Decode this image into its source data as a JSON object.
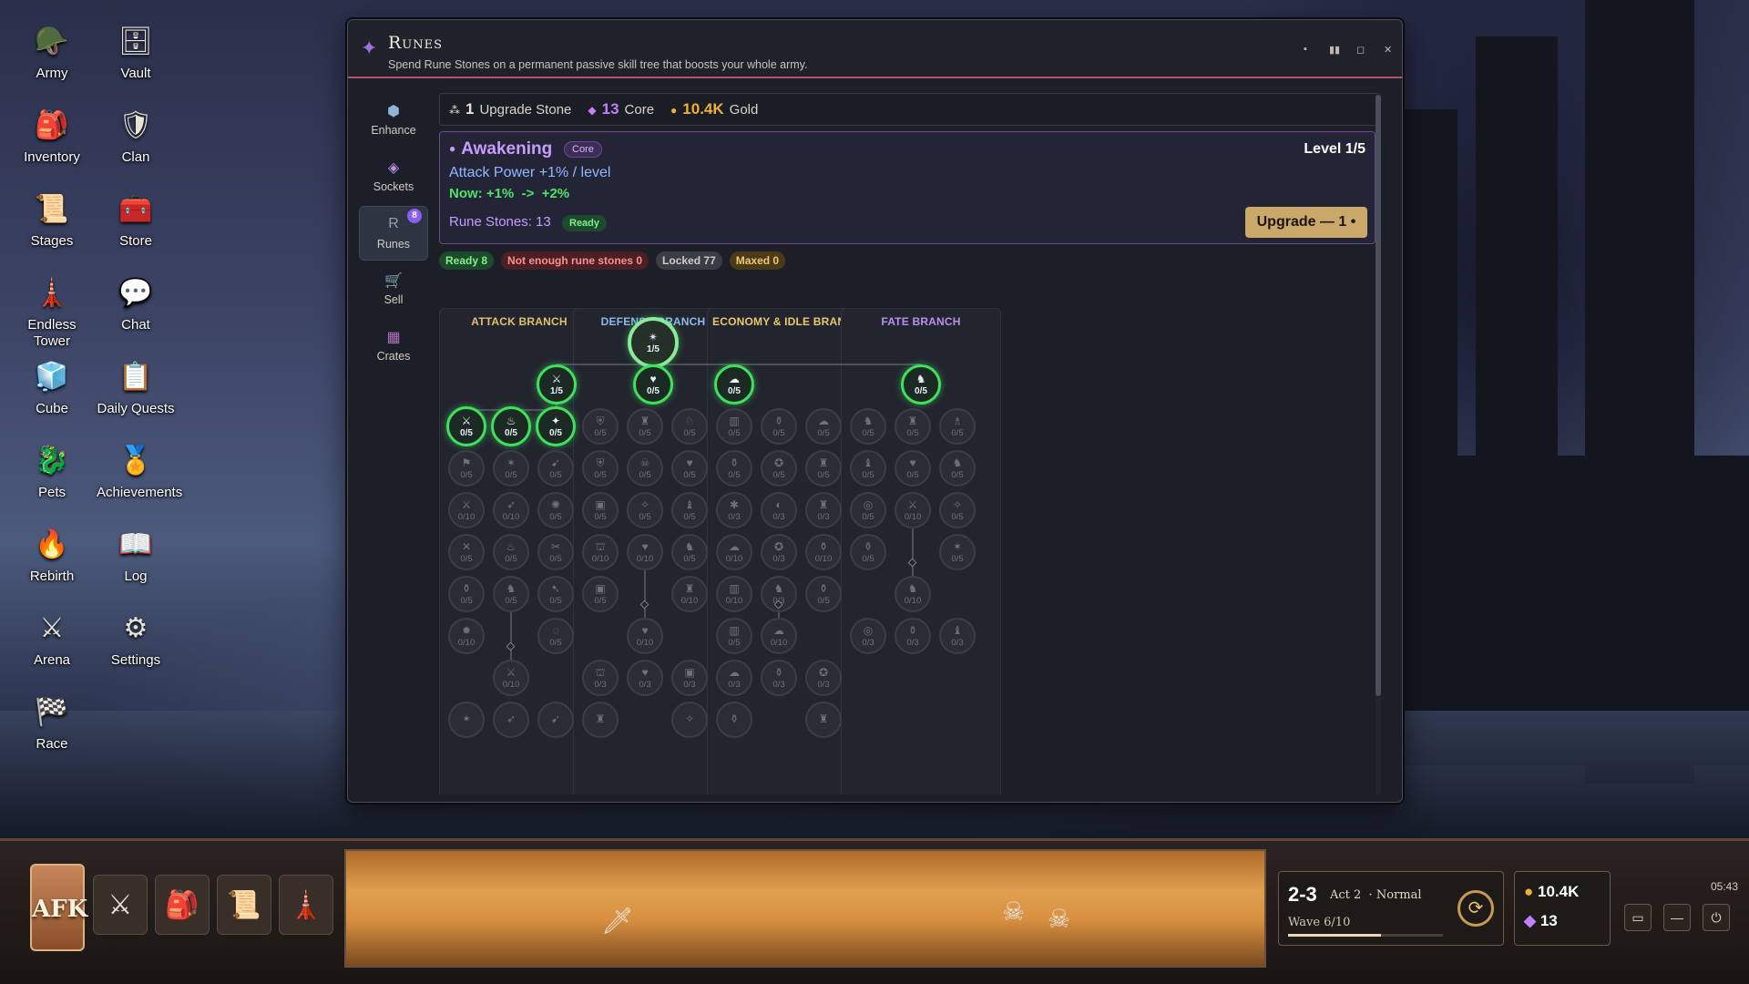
{
  "desktop": {
    "icons": [
      {
        "label": "Army",
        "glyph": "🪖",
        "icon": "army-icon"
      },
      {
        "label": "Vault",
        "glyph": "🗄",
        "icon": "vault-icon"
      },
      {
        "label": "Inventory",
        "glyph": "🎒",
        "icon": "inventory-icon"
      },
      {
        "label": "Clan",
        "glyph": "🛡",
        "icon": "clan-icon"
      },
      {
        "label": "Stages",
        "glyph": "📜",
        "icon": "stages-icon"
      },
      {
        "label": "Store",
        "glyph": "🧰",
        "icon": "store-icon"
      },
      {
        "label": "Endless Tower",
        "glyph": "🗼",
        "icon": "endless-tower-icon"
      },
      {
        "label": "Chat",
        "glyph": "💬",
        "icon": "chat-icon"
      },
      {
        "label": "Cube",
        "glyph": "🧊",
        "icon": "cube-icon"
      },
      {
        "label": "Daily Quests",
        "glyph": "📋",
        "icon": "daily-quests-icon"
      },
      {
        "label": "Pets",
        "glyph": "🐉",
        "icon": "pets-icon"
      },
      {
        "label": "Achievements",
        "glyph": "🏅",
        "icon": "achievements-icon"
      },
      {
        "label": "Rebirth",
        "glyph": "🔥",
        "icon": "rebirth-icon"
      },
      {
        "label": "Log",
        "glyph": "📖",
        "icon": "log-icon"
      },
      {
        "label": "Arena",
        "glyph": "⚔",
        "icon": "arena-icon"
      },
      {
        "label": "Settings",
        "glyph": "⚙",
        "icon": "settings-icon"
      },
      {
        "label": "Race",
        "glyph": "🏁",
        "icon": "race-icon"
      }
    ]
  },
  "window": {
    "title": "Runes",
    "subtitle": "Spend Rune Stones on a permanent passive skill tree that boosts your whole army.",
    "controls": [
      "▪",
      "▮▮",
      "◻",
      "✕"
    ]
  },
  "rail": [
    {
      "label": "Enhance",
      "glyph": "⬢",
      "icon": "enhance-icon",
      "color": "#8fb3d9",
      "active": false
    },
    {
      "label": "Sockets",
      "glyph": "◈",
      "icon": "sockets-icon",
      "color": "#b48ce0",
      "active": false
    },
    {
      "label": "Runes",
      "glyph": "R",
      "icon": "runes-icon",
      "color": "#9a9fb0",
      "active": true,
      "badge": "8"
    },
    {
      "label": "Sell",
      "glyph": "🛒",
      "icon": "sell-icon",
      "color": "#e0c060",
      "active": false
    },
    {
      "label": "Crates",
      "glyph": "▦",
      "icon": "crates-icon",
      "color": "#b070c0",
      "active": false
    }
  ],
  "resources": [
    {
      "value": "1",
      "label": "Upgrade Stone",
      "glyph": "⁂",
      "icon": "upgrade-stone-icon",
      "color": "#e8e4d8"
    },
    {
      "value": "13",
      "label": "Core",
      "glyph": "◆",
      "icon": "core-icon",
      "color": "#c080ff"
    },
    {
      "value": "10.4K",
      "label": "Gold",
      "glyph": "●",
      "icon": "gold-icon",
      "color": "#f0b030"
    }
  ],
  "detail": {
    "name": "Awakening",
    "tag": "Core",
    "level": "Level 1/5",
    "effect": "Attack Power +1% / level",
    "now": "Now: +1%  ->  +2%",
    "stones": "Rune Stones: 13",
    "ready": "Ready",
    "upgrade": "Upgrade — 1 •"
  },
  "filters": {
    "ready": "Ready 8",
    "notenough": "Not enough rune stones 0",
    "locked": "Locked 77",
    "maxed": "Maxed 0"
  },
  "colors": {
    "ready_ring": "#3ee05c",
    "accent": "#b0506a",
    "attack": "#e0c070",
    "defense": "#8fb8f0",
    "economy": "#e8c870",
    "fate": "#b890f0"
  },
  "tree": {
    "branches": [
      {
        "title": "ATTACK BRANCH",
        "color": "#e0c070"
      },
      {
        "title": "DEFENSE BRANCH",
        "color": "#8fb8f0"
      },
      {
        "title": "ECONOMY & IDLE BRANCH",
        "color": "#e8c870"
      },
      {
        "title": "FATE BRANCH",
        "color": "#b890f0"
      }
    ],
    "root": {
      "glyph": "✴",
      "count": "1/5"
    },
    "tier1": [
      {
        "glyph": "⚔",
        "count": "1/5"
      },
      {
        "glyph": "♥",
        "count": "0/5"
      },
      {
        "glyph": "☁",
        "count": "0/5"
      },
      {
        "glyph": "♞",
        "count": "0/5"
      }
    ],
    "attack": [
      [
        {
          "g": "⚔",
          "c": "0/5",
          "s": "ready"
        },
        {
          "g": "♨",
          "c": "0/5",
          "s": "ready"
        },
        {
          "g": "✦",
          "c": "0/5",
          "s": "ready"
        }
      ],
      [
        {
          "g": "⚑",
          "c": "0/5"
        },
        {
          "g": "✶",
          "c": "0/5"
        },
        {
          "g": "➹",
          "c": "0/5"
        }
      ],
      [
        {
          "g": "⚔",
          "c": "0/10"
        },
        {
          "g": "➶",
          "c": "0/10"
        },
        {
          "g": "✺",
          "c": "0/5"
        }
      ],
      [
        {
          "g": "✕",
          "c": "0/5"
        },
        {
          "g": "♨",
          "c": "0/5"
        },
        {
          "g": "✂",
          "c": "0/5"
        }
      ],
      [
        {
          "g": "⚱",
          "c": "0/5"
        },
        {
          "g": "♞",
          "c": "0/5"
        },
        {
          "g": "➷",
          "c": "0/5"
        }
      ],
      [
        {
          "g": "✹",
          "c": "0/10"
        },
        null,
        {
          "g": "◌",
          "c": "0/5"
        }
      ],
      [
        null,
        {
          "g": "⚔",
          "c": "0/10"
        },
        null
      ],
      [
        {
          "g": "✶",
          "c": ""
        },
        {
          "g": "➶",
          "c": ""
        },
        {
          "g": "➹",
          "c": ""
        }
      ]
    ],
    "defense": [
      [
        {
          "g": "⛨",
          "c": "0/5"
        },
        {
          "g": "♜",
          "c": "0/5"
        },
        {
          "g": "♘",
          "c": "0/5"
        }
      ],
      [
        {
          "g": "⛨",
          "c": "0/5"
        },
        {
          "g": "☠",
          "c": "0/5"
        },
        {
          "g": "♥",
          "c": "0/5"
        }
      ],
      [
        {
          "g": "▣",
          "c": "0/5"
        },
        {
          "g": "✧",
          "c": "0/5"
        },
        {
          "g": "♝",
          "c": "0/5"
        }
      ],
      [
        {
          "g": "⛫",
          "c": "0/10"
        },
        {
          "g": "♥",
          "c": "0/10"
        },
        {
          "g": "♞",
          "c": "0/5"
        }
      ],
      [
        {
          "g": "▣",
          "c": "0/5"
        },
        null,
        {
          "g": "♜",
          "c": "0/10"
        }
      ],
      [
        null,
        {
          "g": "♥",
          "c": "0/10"
        },
        null
      ],
      [
        {
          "g": "⛫",
          "c": "0/3"
        },
        {
          "g": "♥",
          "c": "0/3"
        },
        {
          "g": "▣",
          "c": "0/3"
        }
      ],
      [
        {
          "g": "♜",
          "c": ""
        },
        null,
        {
          "g": "✧",
          "c": ""
        }
      ]
    ],
    "economy": [
      [
        {
          "g": "▥",
          "c": "0/5"
        },
        {
          "g": "⚱",
          "c": "0/5"
        },
        {
          "g": "☁",
          "c": "0/5"
        }
      ],
      [
        {
          "g": "⚱",
          "c": "0/5"
        },
        {
          "g": "✪",
          "c": "0/5"
        },
        {
          "g": "♜",
          "c": "0/5"
        }
      ],
      [
        {
          "g": "✱",
          "c": "0/3"
        },
        {
          "g": "◐",
          "c": "0/3"
        },
        {
          "g": "♜",
          "c": "0/3"
        }
      ],
      [
        {
          "g": "☁",
          "c": "0/10"
        },
        {
          "g": "✪",
          "c": "0/3"
        },
        {
          "g": "⚱",
          "c": "0/10"
        }
      ],
      [
        {
          "g": "▥",
          "c": "0/10"
        },
        {
          "g": "♞",
          "c": "0/3"
        },
        {
          "g": "⚱",
          "c": "0/5"
        }
      ],
      [
        {
          "g": "▥",
          "c": "0/5"
        },
        {
          "g": "☁",
          "c": "0/10"
        },
        null
      ],
      [
        {
          "g": "☁",
          "c": "0/3"
        },
        {
          "g": "⚱",
          "c": "0/3"
        },
        {
          "g": "✪",
          "c": "0/3"
        }
      ],
      [
        {
          "g": "⚱",
          "c": ""
        },
        null,
        {
          "g": "♜",
          "c": ""
        }
      ]
    ],
    "fate": [
      [
        {
          "g": "♞",
          "c": "0/5"
        },
        {
          "g": "♜",
          "c": "0/5"
        },
        {
          "g": "♗",
          "c": "0/5"
        }
      ],
      [
        {
          "g": "♝",
          "c": "0/5"
        },
        {
          "g": "♥",
          "c": "0/5"
        },
        {
          "g": "♞",
          "c": "0/5"
        }
      ],
      [
        {
          "g": "◎",
          "c": "0/5"
        },
        {
          "g": "⚔",
          "c": "0/10"
        },
        {
          "g": "✧",
          "c": "0/5"
        }
      ],
      [
        {
          "g": "⚱",
          "c": "0/5"
        },
        null,
        {
          "g": "✶",
          "c": "0/5"
        }
      ],
      [
        null,
        {
          "g": "♞",
          "c": "0/10"
        },
        null
      ],
      [
        {
          "g": "◎",
          "c": "0/3"
        },
        {
          "g": "⚱",
          "c": "0/3"
        },
        {
          "g": "♝",
          "c": "0/3"
        }
      ]
    ]
  },
  "taskbar": {
    "afk": "AFK",
    "quick": [
      {
        "glyph": "⚔",
        "icon": "army-quick-icon"
      },
      {
        "glyph": "🎒",
        "icon": "inventory-quick-icon"
      },
      {
        "glyph": "📜",
        "icon": "stages-quick-icon"
      },
      {
        "glyph": "🗼",
        "icon": "tower-quick-icon"
      }
    ],
    "stage": "2-3",
    "act": "Act 2  · Normal",
    "wave": "Wave 6/10",
    "wave_progress": 0.6,
    "gold": "10.4K",
    "core": "13",
    "clock": "05:43",
    "sys": [
      "▭",
      "—",
      "⏻"
    ]
  }
}
